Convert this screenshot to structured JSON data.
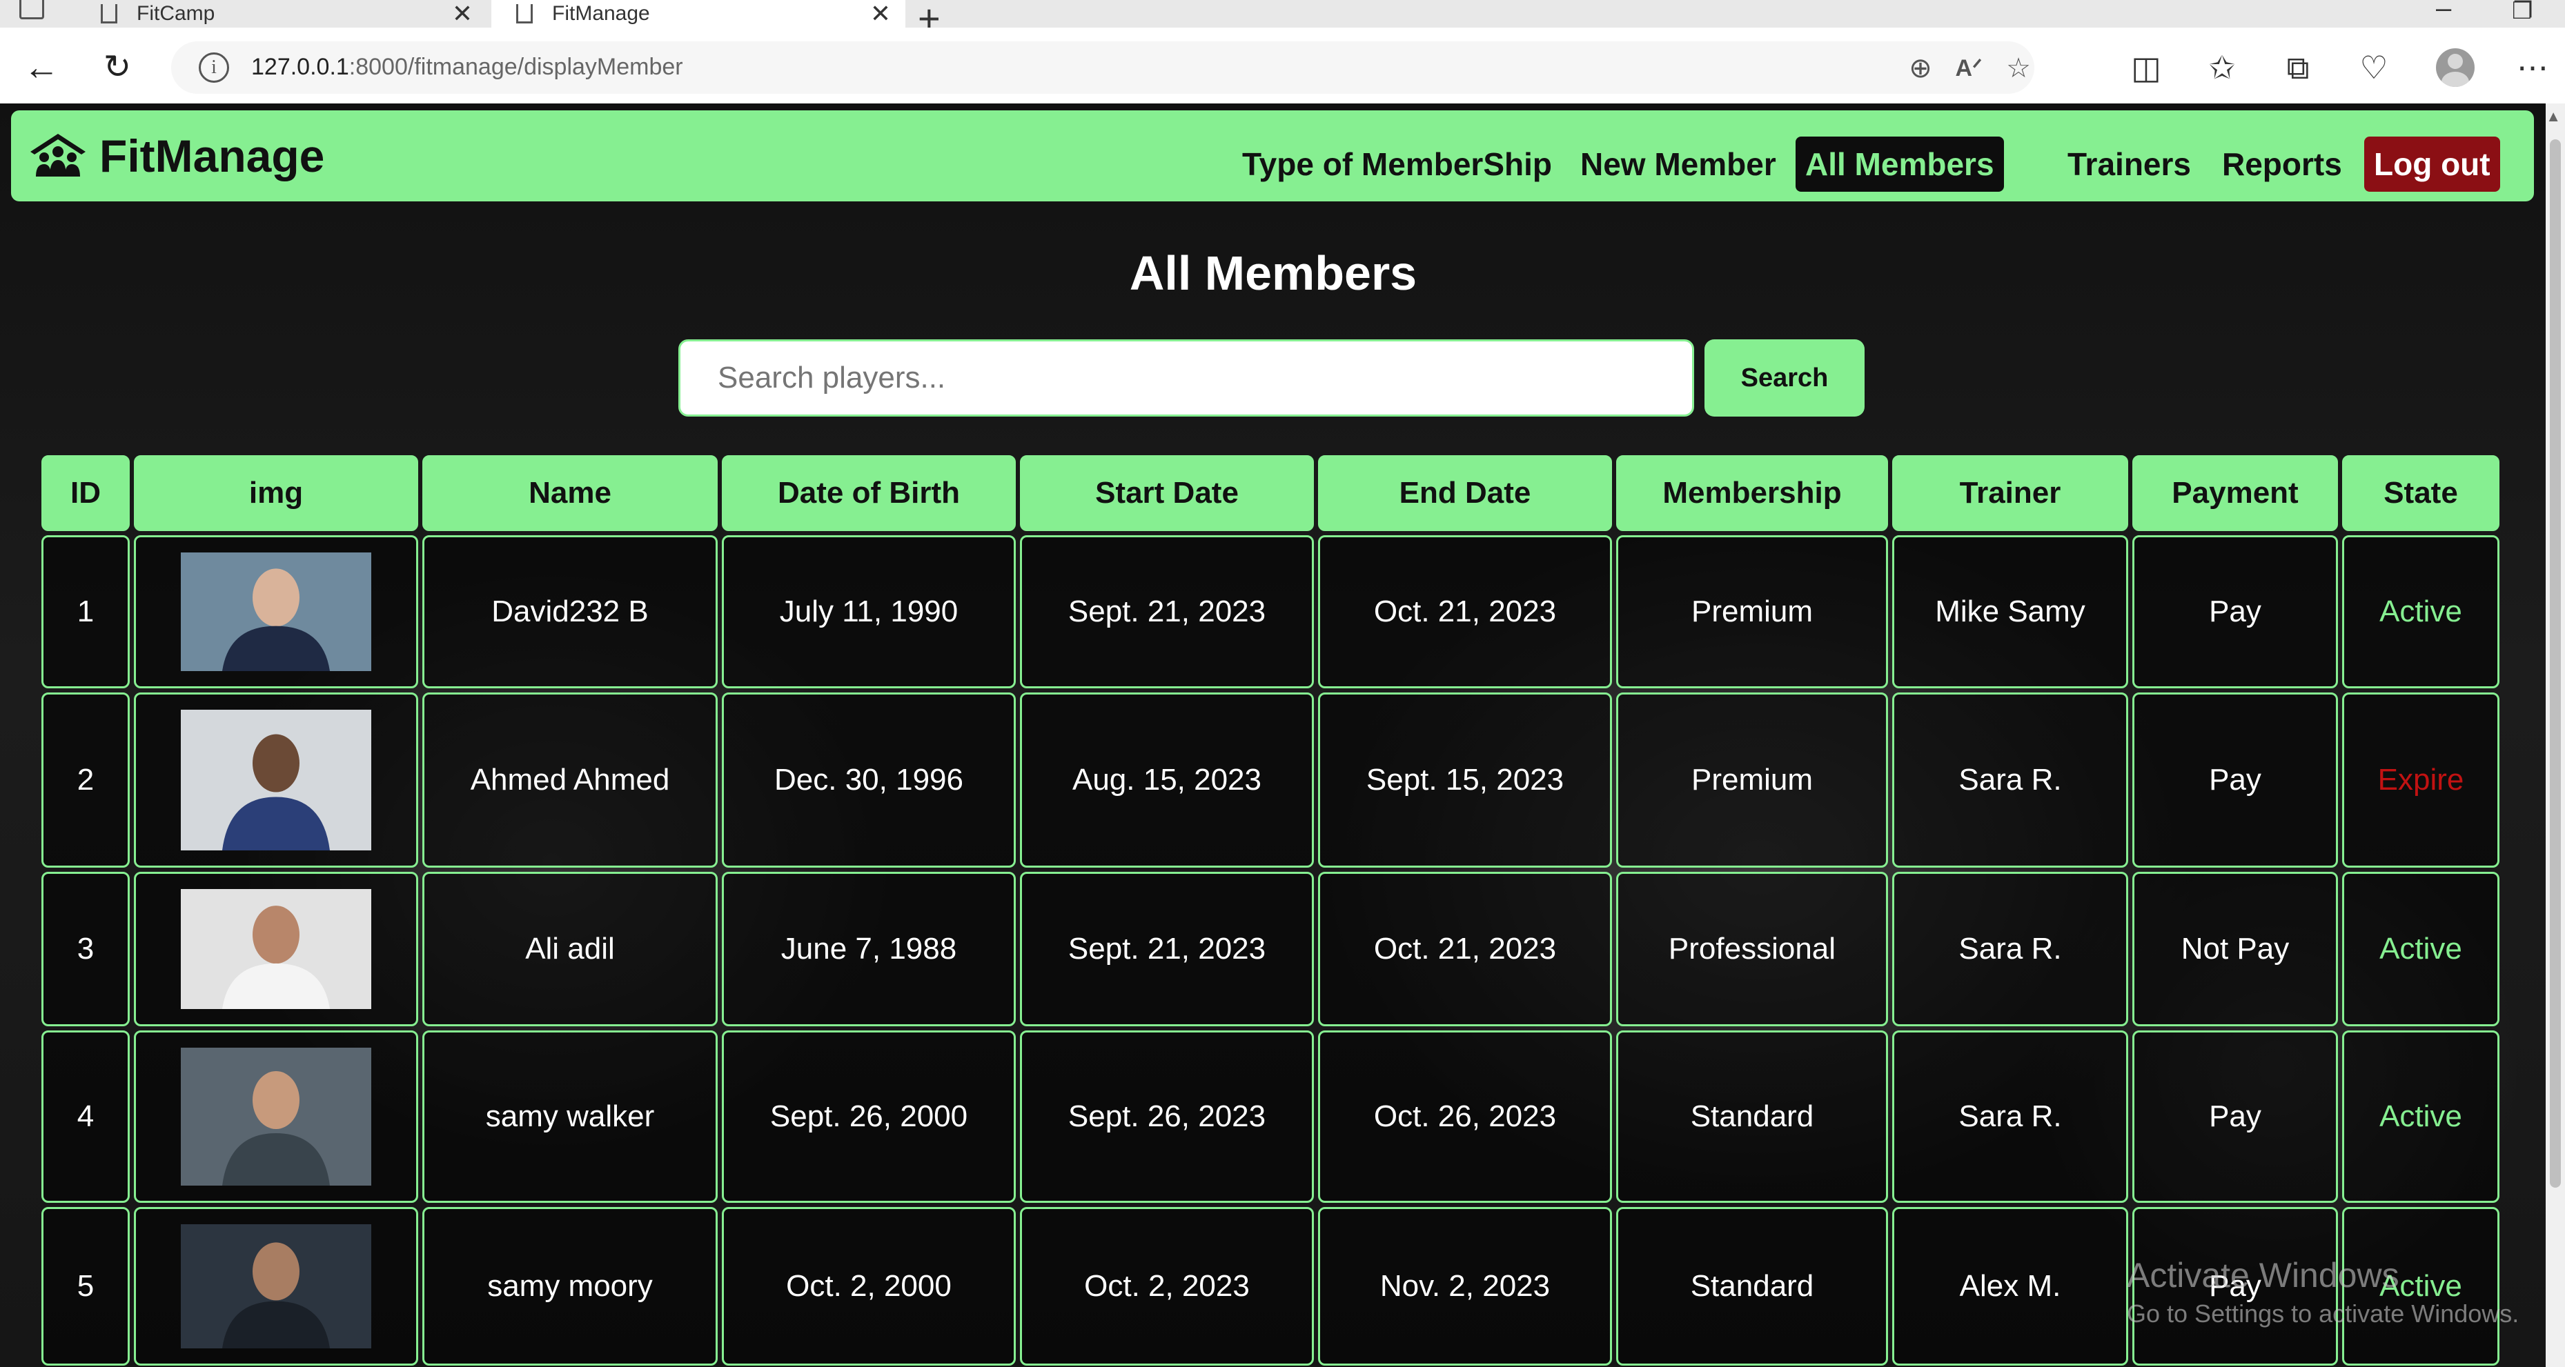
{
  "browser": {
    "tabs": [
      {
        "label": "FitCamp",
        "active": false
      },
      {
        "label": "FitManage",
        "active": true
      }
    ],
    "url_host": "127.0.0.1",
    "url_path": ":8000/fitmanage/displayMember",
    "icons": [
      "back-icon",
      "reload-icon",
      "info-icon",
      "zoom-icon",
      "read-aloud-icon",
      "favorite-icon",
      "split-screen-icon",
      "favorites-icon",
      "collections-icon",
      "health-icon",
      "profile-icon",
      "more-icon"
    ]
  },
  "navbar": {
    "brand": "FitManage",
    "links": [
      {
        "label": "Type of MemberShip",
        "active": false
      },
      {
        "label": "New Member",
        "active": false
      },
      {
        "label": "All Members",
        "active": true
      },
      {
        "label": "Trainers",
        "active": false
      },
      {
        "label": "Reports",
        "active": false
      }
    ],
    "logout": "Log out",
    "colors": {
      "accent": "#86ef91",
      "active_bg": "#0d0d0d",
      "logout_bg": "#8b0f14"
    }
  },
  "main": {
    "title": "All Members",
    "search": {
      "placeholder": "Search players...",
      "button": "Search"
    },
    "table": {
      "headers": [
        "ID",
        "img",
        "Name",
        "Date of Birth",
        "Start Date",
        "End Date",
        "Membership",
        "Trainer",
        "Payment",
        "State"
      ],
      "rows": [
        {
          "id": "1",
          "name": "David232 B",
          "dob": "July 11, 1990",
          "start": "Sept. 21, 2023",
          "end": "Oct. 21, 2023",
          "membership": "Premium",
          "trainer": "Mike Samy",
          "payment": "Pay",
          "state": "Active"
        },
        {
          "id": "2",
          "name": "Ahmed Ahmed",
          "dob": "Dec. 30, 1996",
          "start": "Aug. 15, 2023",
          "end": "Sept. 15, 2023",
          "membership": "Premium",
          "trainer": "Sara R.",
          "payment": "Pay",
          "state": "Expire"
        },
        {
          "id": "3",
          "name": "Ali adil",
          "dob": "June 7, 1988",
          "start": "Sept. 21, 2023",
          "end": "Oct. 21, 2023",
          "membership": "Professional",
          "trainer": "Sara R.",
          "payment": "Not Pay",
          "state": "Active"
        },
        {
          "id": "4",
          "name": "samy walker",
          "dob": "Sept. 26, 2000",
          "start": "Sept. 26, 2023",
          "end": "Oct. 26, 2023",
          "membership": "Standard",
          "trainer": "Sara R.",
          "payment": "Pay",
          "state": "Active"
        },
        {
          "id": "5",
          "name": "samy moory",
          "dob": "Oct. 2, 2000",
          "start": "Oct. 2, 2023",
          "end": "Nov. 2, 2023",
          "membership": "Standard",
          "trainer": "Alex M.",
          "payment": "Pay",
          "state": "Active"
        }
      ]
    },
    "state_colors": {
      "Active": "#86ef91",
      "Expire": "#c21212"
    }
  },
  "os_watermark": {
    "line1": "Activate Windows",
    "line2": "Go to Settings to activate Windows."
  }
}
